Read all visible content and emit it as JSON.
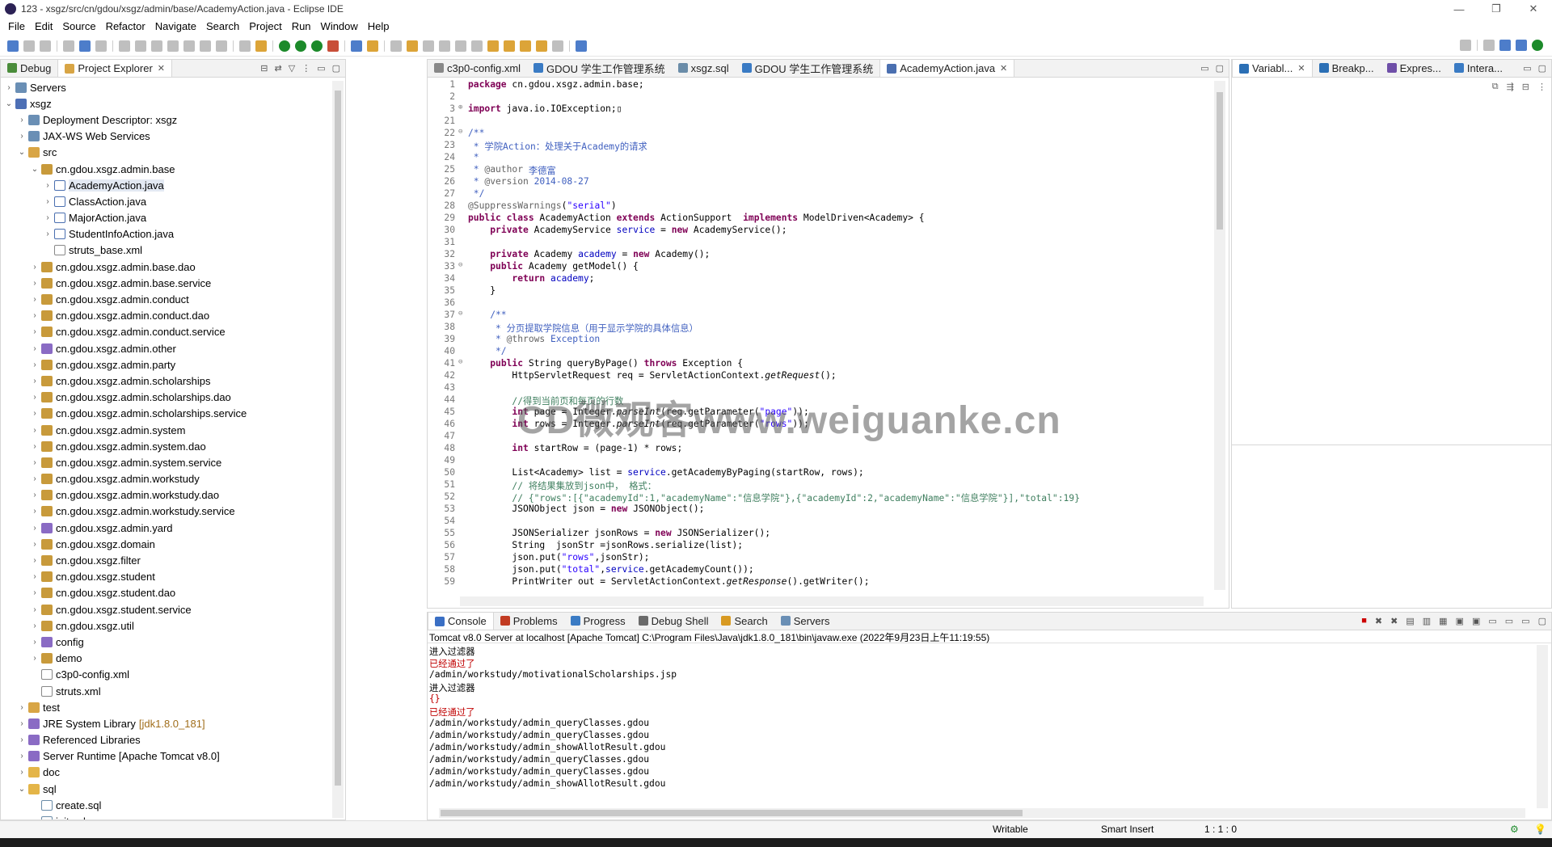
{
  "window": {
    "title": "123 - xsgz/src/cn/gdou/xsgz/admin/base/AcademyAction.java - Eclipse IDE"
  },
  "menu": [
    "File",
    "Edit",
    "Source",
    "Refactor",
    "Navigate",
    "Search",
    "Project",
    "Run",
    "Window",
    "Help"
  ],
  "explorer": {
    "tabs": [
      "Debug",
      "Project Explorer"
    ],
    "tree": [
      {
        "indent": 0,
        "tw": ">",
        "icon": "server",
        "label": "Servers"
      },
      {
        "indent": 0,
        "tw": "v",
        "icon": "project",
        "label": "xsgz"
      },
      {
        "indent": 1,
        "tw": ">",
        "icon": "server",
        "label": "Deployment Descriptor: xsgz"
      },
      {
        "indent": 1,
        "tw": ">",
        "icon": "server",
        "label": "JAX-WS Web Services"
      },
      {
        "indent": 1,
        "tw": "v",
        "icon": "srcf",
        "label": "src"
      },
      {
        "indent": 2,
        "tw": "v",
        "icon": "package",
        "label": "cn.gdou.xsgz.admin.base"
      },
      {
        "indent": 3,
        "tw": ">",
        "icon": "java",
        "label": "AcademyAction.java",
        "selected": true
      },
      {
        "indent": 3,
        "tw": ">",
        "icon": "java",
        "label": "ClassAction.java"
      },
      {
        "indent": 3,
        "tw": ">",
        "icon": "java",
        "label": "MajorAction.java"
      },
      {
        "indent": 3,
        "tw": ">",
        "icon": "java",
        "label": "StudentInfoAction.java"
      },
      {
        "indent": 3,
        "tw": "",
        "icon": "xml",
        "label": "struts_base.xml"
      },
      {
        "indent": 2,
        "tw": ">",
        "icon": "package",
        "label": "cn.gdou.xsgz.admin.base.dao"
      },
      {
        "indent": 2,
        "tw": ">",
        "icon": "package",
        "label": "cn.gdou.xsgz.admin.base.service"
      },
      {
        "indent": 2,
        "tw": ">",
        "icon": "package",
        "label": "cn.gdou.xsgz.admin.conduct"
      },
      {
        "indent": 2,
        "tw": ">",
        "icon": "package",
        "label": "cn.gdou.xsgz.admin.conduct.dao"
      },
      {
        "indent": 2,
        "tw": ">",
        "icon": "package",
        "label": "cn.gdou.xsgz.admin.conduct.service"
      },
      {
        "indent": 2,
        "tw": ">",
        "icon": "lib",
        "label": "cn.gdou.xsgz.admin.other"
      },
      {
        "indent": 2,
        "tw": ">",
        "icon": "package",
        "label": "cn.gdou.xsgz.admin.party"
      },
      {
        "indent": 2,
        "tw": ">",
        "icon": "package",
        "label": "cn.gdou.xsgz.admin.scholarships"
      },
      {
        "indent": 2,
        "tw": ">",
        "icon": "package",
        "label": "cn.gdou.xsgz.admin.scholarships.dao"
      },
      {
        "indent": 2,
        "tw": ">",
        "icon": "package",
        "label": "cn.gdou.xsgz.admin.scholarships.service"
      },
      {
        "indent": 2,
        "tw": ">",
        "icon": "package",
        "label": "cn.gdou.xsgz.admin.system"
      },
      {
        "indent": 2,
        "tw": ">",
        "icon": "package",
        "label": "cn.gdou.xsgz.admin.system.dao"
      },
      {
        "indent": 2,
        "tw": ">",
        "icon": "package",
        "label": "cn.gdou.xsgz.admin.system.service"
      },
      {
        "indent": 2,
        "tw": ">",
        "icon": "package",
        "label": "cn.gdou.xsgz.admin.workstudy"
      },
      {
        "indent": 2,
        "tw": ">",
        "icon": "package",
        "label": "cn.gdou.xsgz.admin.workstudy.dao"
      },
      {
        "indent": 2,
        "tw": ">",
        "icon": "package",
        "label": "cn.gdou.xsgz.admin.workstudy.service"
      },
      {
        "indent": 2,
        "tw": ">",
        "icon": "lib",
        "label": "cn.gdou.xsgz.admin.yard"
      },
      {
        "indent": 2,
        "tw": ">",
        "icon": "package",
        "label": "cn.gdou.xsgz.domain"
      },
      {
        "indent": 2,
        "tw": ">",
        "icon": "package",
        "label": "cn.gdou.xsgz.filter"
      },
      {
        "indent": 2,
        "tw": ">",
        "icon": "package",
        "label": "cn.gdou.xsgz.student"
      },
      {
        "indent": 2,
        "tw": ">",
        "icon": "package",
        "label": "cn.gdou.xsgz.student.dao"
      },
      {
        "indent": 2,
        "tw": ">",
        "icon": "package",
        "label": "cn.gdou.xsgz.student.service"
      },
      {
        "indent": 2,
        "tw": ">",
        "icon": "package",
        "label": "cn.gdou.xsgz.util"
      },
      {
        "indent": 2,
        "tw": ">",
        "icon": "lib",
        "label": "config"
      },
      {
        "indent": 2,
        "tw": ">",
        "icon": "package",
        "label": "demo"
      },
      {
        "indent": 2,
        "tw": "",
        "icon": "xml",
        "label": "c3p0-config.xml"
      },
      {
        "indent": 2,
        "tw": "",
        "icon": "xml",
        "label": "struts.xml"
      },
      {
        "indent": 1,
        "tw": ">",
        "icon": "srcf",
        "label": "test"
      },
      {
        "indent": 1,
        "tw": ">",
        "icon": "lib",
        "label": "JRE System Library",
        "suffix": "[jdk1.8.0_181]"
      },
      {
        "indent": 1,
        "tw": ">",
        "icon": "lib",
        "label": "Referenced Libraries"
      },
      {
        "indent": 1,
        "tw": ">",
        "icon": "lib",
        "label": "Server Runtime [Apache Tomcat v8.0]"
      },
      {
        "indent": 1,
        "tw": ">",
        "icon": "folder",
        "label": "doc"
      },
      {
        "indent": 1,
        "tw": "v",
        "icon": "folder",
        "label": "sql"
      },
      {
        "indent": 2,
        "tw": "",
        "icon": "sql",
        "label": "create.sql"
      },
      {
        "indent": 2,
        "tw": "",
        "icon": "sql",
        "label": "init.sql"
      }
    ]
  },
  "editor": {
    "tabs": [
      {
        "label": "c3p0-config.xml",
        "icon": "xml"
      },
      {
        "label": "GDOU 学生工作管理系统",
        "icon": "web"
      },
      {
        "label": "xsgz.sql",
        "icon": "sql"
      },
      {
        "label": "GDOU 学生工作管理系统",
        "icon": "web"
      },
      {
        "label": "AcademyAction.java",
        "icon": "java",
        "active": true
      }
    ],
    "lines": [
      {
        "n": "1",
        "f": "",
        "seg": [
          [
            "kw",
            "package "
          ],
          [
            "ct",
            "cn.gdou.xsgz.admin.base;"
          ]
        ]
      },
      {
        "n": "2",
        "f": "",
        "seg": []
      },
      {
        "n": "3",
        "f": "⊕",
        "seg": [
          [
            "kw",
            "import "
          ],
          [
            "ct",
            "java.io.IOException;▯"
          ]
        ]
      },
      {
        "n": "21",
        "f": "",
        "seg": []
      },
      {
        "n": "22",
        "f": "⊖",
        "seg": [
          [
            "jd",
            "/**"
          ]
        ]
      },
      {
        "n": "23",
        "f": "",
        "seg": [
          [
            "jd",
            " * 学院Action：处理关于Academy的请求"
          ]
        ]
      },
      {
        "n": "24",
        "f": "",
        "seg": [
          [
            "jd",
            " *"
          ]
        ]
      },
      {
        "n": "25",
        "f": "",
        "seg": [
          [
            "jd",
            " * "
          ],
          [
            "an",
            "@author"
          ],
          [
            "jd",
            " 李德富"
          ]
        ]
      },
      {
        "n": "26",
        "f": "",
        "seg": [
          [
            "jd",
            " * "
          ],
          [
            "an",
            "@version"
          ],
          [
            "jd",
            " 2014-08-27"
          ]
        ]
      },
      {
        "n": "27",
        "f": "",
        "seg": [
          [
            "jd",
            " */"
          ]
        ]
      },
      {
        "n": "28",
        "f": "",
        "seg": [
          [
            "an",
            "@SuppressWarnings"
          ],
          [
            "ct",
            "("
          ],
          [
            "st",
            "\"serial\""
          ],
          [
            "ct",
            ")"
          ]
        ]
      },
      {
        "n": "29",
        "f": "",
        "seg": [
          [
            "kw",
            "public class "
          ],
          [
            "ct",
            "AcademyAction "
          ],
          [
            "kw",
            "extends "
          ],
          [
            "ct",
            "ActionSupport  "
          ],
          [
            "kw",
            "implements "
          ],
          [
            "ct",
            "ModelDriven<Academy> {"
          ]
        ]
      },
      {
        "n": "30",
        "f": "",
        "seg": [
          [
            "ct",
            "    "
          ],
          [
            "kw",
            "private "
          ],
          [
            "ct",
            "AcademyService "
          ],
          [
            "fd",
            "service"
          ],
          [
            "ct",
            " = "
          ],
          [
            "kw",
            "new "
          ],
          [
            "ct",
            "AcademyService();"
          ]
        ]
      },
      {
        "n": "31",
        "f": "",
        "seg": []
      },
      {
        "n": "32",
        "f": "",
        "seg": [
          [
            "ct",
            "    "
          ],
          [
            "kw",
            "private "
          ],
          [
            "ct",
            "Academy "
          ],
          [
            "fd",
            "academy"
          ],
          [
            "ct",
            " = "
          ],
          [
            "kw",
            "new "
          ],
          [
            "ct",
            "Academy();"
          ]
        ]
      },
      {
        "n": "33",
        "f": "⊖",
        "seg": [
          [
            "ct",
            "    "
          ],
          [
            "kw",
            "public "
          ],
          [
            "ct",
            "Academy getModel() {"
          ]
        ]
      },
      {
        "n": "34",
        "f": "",
        "seg": [
          [
            "ct",
            "        "
          ],
          [
            "kw",
            "return "
          ],
          [
            "fd",
            "academy"
          ],
          [
            "ct",
            ";"
          ]
        ]
      },
      {
        "n": "35",
        "f": "",
        "seg": [
          [
            "ct",
            "    }"
          ]
        ]
      },
      {
        "n": "36",
        "f": "",
        "seg": []
      },
      {
        "n": "37",
        "f": "⊖",
        "seg": [
          [
            "jd",
            "    /**"
          ]
        ]
      },
      {
        "n": "38",
        "f": "",
        "seg": [
          [
            "jd",
            "     * 分页提取学院信息（用于显示学院的具体信息）"
          ]
        ]
      },
      {
        "n": "39",
        "f": "",
        "seg": [
          [
            "jd",
            "     * "
          ],
          [
            "an",
            "@throws"
          ],
          [
            "jd",
            " Exception"
          ]
        ]
      },
      {
        "n": "40",
        "f": "",
        "seg": [
          [
            "jd",
            "     */"
          ]
        ]
      },
      {
        "n": "41",
        "f": "⊖",
        "seg": [
          [
            "ct",
            "    "
          ],
          [
            "kw",
            "public "
          ],
          [
            "ct",
            "String queryByPage() "
          ],
          [
            "kw",
            "throws "
          ],
          [
            "ct",
            "Exception {"
          ]
        ]
      },
      {
        "n": "42",
        "f": "",
        "seg": [
          [
            "ct",
            "        HttpServletRequest req = ServletActionContext."
          ],
          [
            "it",
            "getRequest"
          ],
          [
            "ct",
            "();"
          ]
        ]
      },
      {
        "n": "43",
        "f": "",
        "seg": []
      },
      {
        "n": "44",
        "f": "",
        "seg": [
          [
            "cm",
            "        //得到当前页和每页的行数"
          ]
        ]
      },
      {
        "n": "45",
        "f": "",
        "seg": [
          [
            "ct",
            "        "
          ],
          [
            "kw",
            "int "
          ],
          [
            "ct",
            "page = Integer."
          ],
          [
            "it",
            "parseInt"
          ],
          [
            "ct",
            "(req.getParameter("
          ],
          [
            "st",
            "\"page\""
          ],
          [
            "ct",
            "));"
          ]
        ]
      },
      {
        "n": "46",
        "f": "",
        "seg": [
          [
            "ct",
            "        "
          ],
          [
            "kw",
            "int "
          ],
          [
            "ct",
            "rows = Integer."
          ],
          [
            "it",
            "parseInt"
          ],
          [
            "ct",
            "(req.getParameter("
          ],
          [
            "st",
            "\"rows\""
          ],
          [
            "ct",
            "));"
          ]
        ]
      },
      {
        "n": "47",
        "f": "",
        "seg": []
      },
      {
        "n": "48",
        "f": "",
        "seg": [
          [
            "ct",
            "        "
          ],
          [
            "kw",
            "int "
          ],
          [
            "ct",
            "startRow = (page-1) * rows;"
          ]
        ]
      },
      {
        "n": "49",
        "f": "",
        "seg": []
      },
      {
        "n": "50",
        "f": "",
        "seg": [
          [
            "ct",
            "        List<Academy> list = "
          ],
          [
            "fd",
            "service"
          ],
          [
            "ct",
            ".getAcademyByPaging(startRow, rows);"
          ]
        ]
      },
      {
        "n": "51",
        "f": "",
        "seg": [
          [
            "cm",
            "        // 将结果集放到json中， 格式："
          ]
        ]
      },
      {
        "n": "52",
        "f": "",
        "seg": [
          [
            "cm",
            "        // {\"rows\":[{\"academyId\":1,\"academyName\":\"信息学院\"},{\"academyId\":2,\"academyName\":\"信息学院\"}],\"total\":19}"
          ]
        ]
      },
      {
        "n": "53",
        "f": "",
        "seg": [
          [
            "ct",
            "        JSONObject json = "
          ],
          [
            "kw",
            "new "
          ],
          [
            "ct",
            "JSONObject();"
          ]
        ]
      },
      {
        "n": "54",
        "f": "",
        "seg": []
      },
      {
        "n": "55",
        "f": "",
        "seg": [
          [
            "ct",
            "        JSONSerializer jsonRows = "
          ],
          [
            "kw",
            "new "
          ],
          [
            "ct",
            "JSONSerializer();"
          ]
        ]
      },
      {
        "n": "56",
        "f": "",
        "seg": [
          [
            "ct",
            "        String  jsonStr =jsonRows.serialize(list);"
          ]
        ]
      },
      {
        "n": "57",
        "f": "",
        "seg": [
          [
            "ct",
            "        json.put("
          ],
          [
            "st",
            "\"rows\""
          ],
          [
            "ct",
            ",jsonStr);"
          ]
        ]
      },
      {
        "n": "58",
        "f": "",
        "seg": [
          [
            "ct",
            "        json.put("
          ],
          [
            "st",
            "\"total\""
          ],
          [
            "ct",
            ","
          ],
          [
            "fd",
            "service"
          ],
          [
            "ct",
            ".getAcademyCount());"
          ]
        ]
      },
      {
        "n": "59",
        "f": "",
        "seg": [
          [
            "ct",
            "        PrintWriter out = ServletActionContext."
          ],
          [
            "it",
            "getResponse"
          ],
          [
            "ct",
            "().getWriter();"
          ]
        ]
      }
    ]
  },
  "rightview": {
    "tabs": [
      "Variabl...",
      "Breakp...",
      "Expres...",
      "Intera..."
    ]
  },
  "console": {
    "tabs": [
      "Console",
      "Problems",
      "Progress",
      "Debug Shell",
      "Search",
      "Servers"
    ],
    "header": "Tomcat v8.0 Server at localhost [Apache Tomcat] C:\\Program Files\\Java\\jdk1.8.0_181\\bin\\javaw.exe  (2022年9月23日上午11:19:55)",
    "lines": [
      {
        "t": "进入过滤器",
        "red": false
      },
      {
        "t": "已经通过了",
        "red": true
      },
      {
        "t": "/admin/workstudy/motivationalScholarships.jsp",
        "red": false
      },
      {
        "t": "进入过滤器",
        "red": false
      },
      {
        "t": "{}",
        "red": true
      },
      {
        "t": "已经通过了",
        "red": true
      },
      {
        "t": "/admin/workstudy/admin_queryClasses.gdou",
        "red": false
      },
      {
        "t": "/admin/workstudy/admin_queryClasses.gdou",
        "red": false
      },
      {
        "t": "/admin/workstudy/admin_showAllotResult.gdou",
        "red": false
      },
      {
        "t": "/admin/workstudy/admin_queryClasses.gdou",
        "red": false
      },
      {
        "t": "/admin/workstudy/admin_queryClasses.gdou",
        "red": false
      },
      {
        "t": "/admin/workstudy/admin_showAllotResult.gdou",
        "red": false
      }
    ]
  },
  "status": {
    "writable": "Writable",
    "insert": "Smart Insert",
    "pos": "1 : 1 : 0"
  },
  "watermark": "CD微观客www.weiguanke.cn"
}
